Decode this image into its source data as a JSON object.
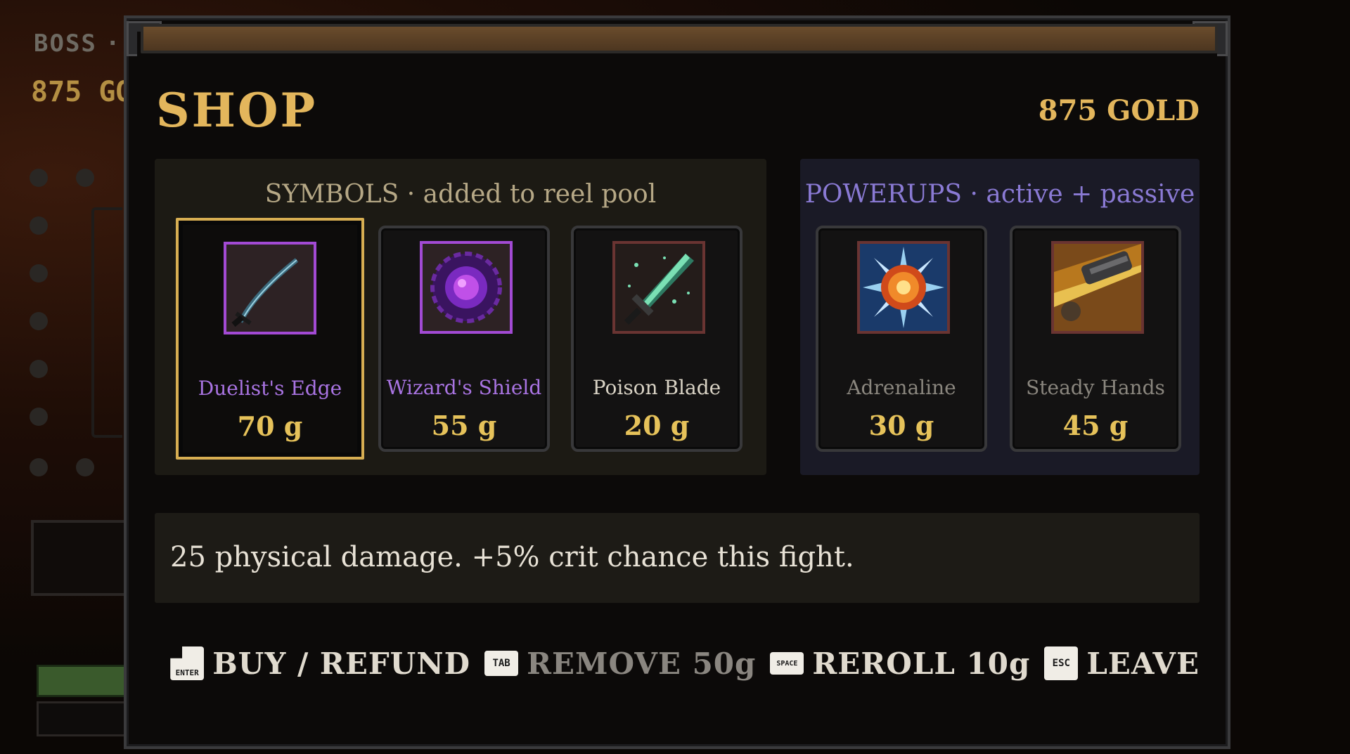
{
  "background": {
    "label": "BOSS",
    "separator": "·",
    "gold_text": "875 GO"
  },
  "shop": {
    "title": "SHOP",
    "gold": "875 GOLD"
  },
  "symbols": {
    "header": "SYMBOLS · added to reel pool",
    "items": [
      {
        "name": "Duelist's Edge",
        "price": "70 g",
        "icon": "curved-sword-icon",
        "rarity_color": "#a24ad4",
        "selected": true
      },
      {
        "name": "Wizard's Shield",
        "price": "55 g",
        "icon": "purple-orb-shield-icon",
        "rarity_color": "#a24ad4",
        "selected": false
      },
      {
        "name": "Poison Blade",
        "price": "20 g",
        "icon": "poison-dagger-icon",
        "rarity_color": "#6a3432",
        "selected": false
      }
    ]
  },
  "powerups": {
    "header": "POWERUPS · active + passive",
    "items": [
      {
        "name": "Adrenaline",
        "price": "30 g",
        "icon": "burst-icon"
      },
      {
        "name": "Steady Hands",
        "price": "45 g",
        "icon": "gauntlet-icon"
      }
    ]
  },
  "description": "25 physical damage. +5% crit chance this fight.",
  "controls": [
    {
      "key": "ENTER",
      "label": "BUY / REFUND",
      "dim": false
    },
    {
      "key": "TAB",
      "label": "REMOVE 50g",
      "dim": true
    },
    {
      "key": "SPACE",
      "label": "REROLL 10g",
      "dim": false
    },
    {
      "key": "ESC",
      "label": "LEAVE",
      "dim": false
    }
  ],
  "colors": {
    "accent_gold": "#e3b65c",
    "price_gold": "#e6c25a",
    "symbol_header": "#b6a886",
    "powerup_header": "#8a7ad4",
    "rare_purple": "#a974e2"
  }
}
